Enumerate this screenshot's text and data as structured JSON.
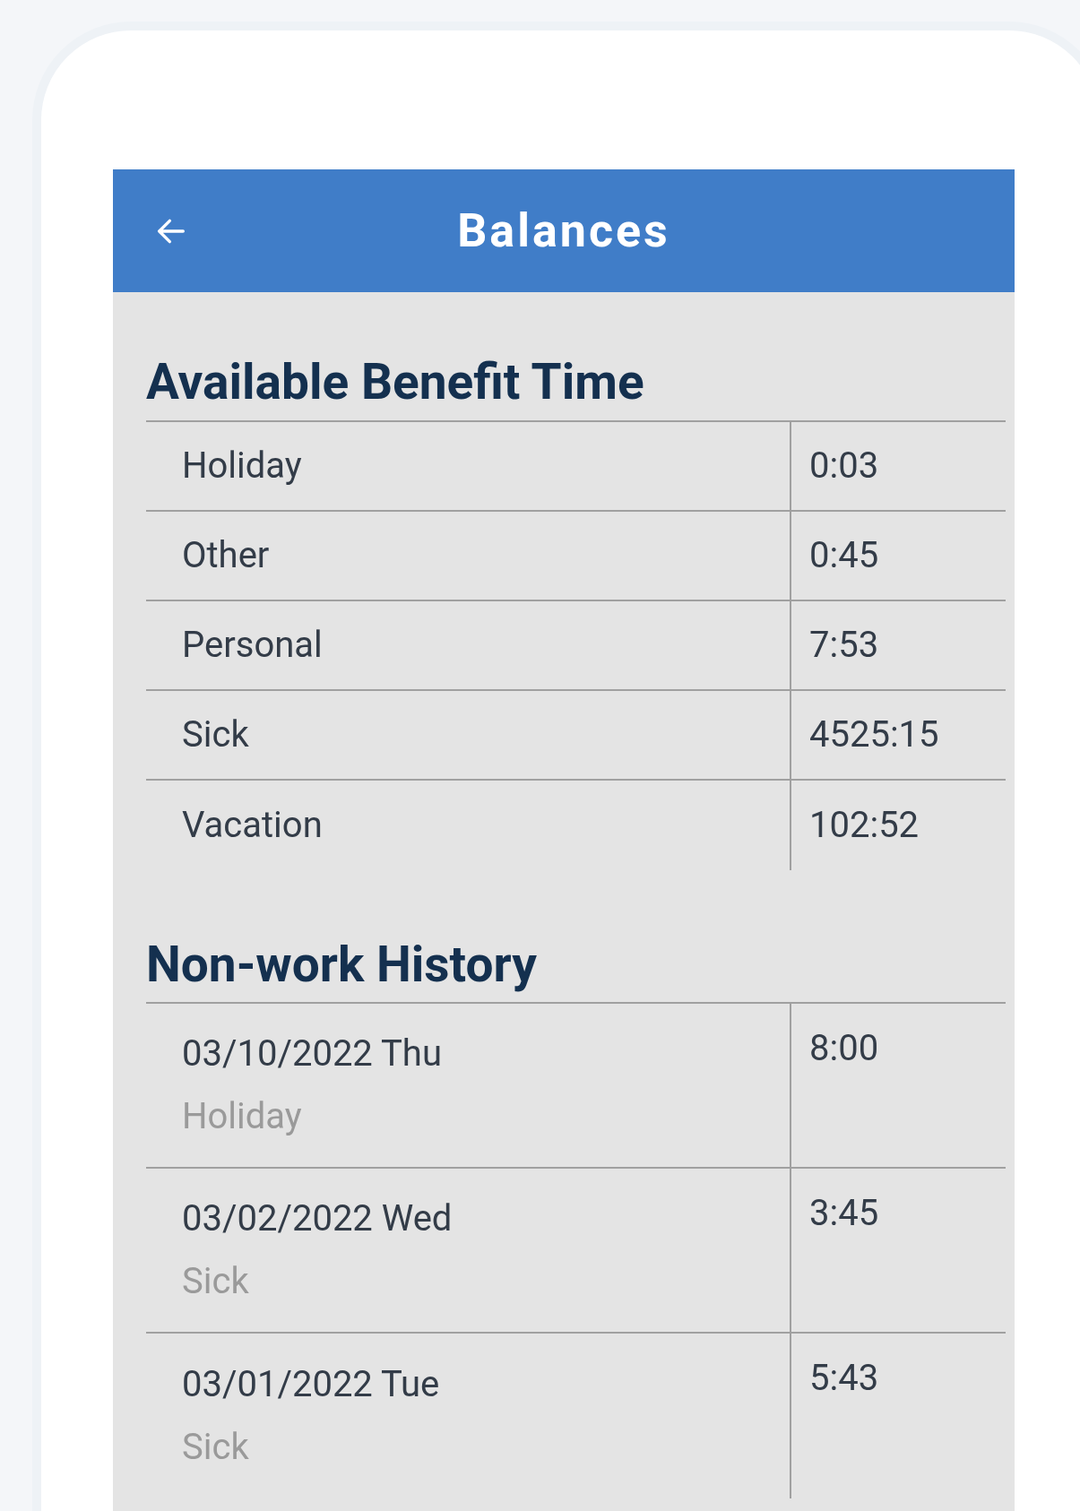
{
  "app_bar": {
    "title": "Balances"
  },
  "benefit_time": {
    "heading": "Available Benefit Time",
    "rows": [
      {
        "type": "Holiday",
        "balance": "0:03"
      },
      {
        "type": "Other",
        "balance": "0:45"
      },
      {
        "type": "Personal",
        "balance": "7:53"
      },
      {
        "type": "Sick",
        "balance": "4525:15"
      },
      {
        "type": "Vacation",
        "balance": "102:52"
      }
    ]
  },
  "non_work_history": {
    "heading": "Non-work History",
    "rows": [
      {
        "date": "03/10/2022 Thu",
        "type": "Holiday",
        "hours": "8:00"
      },
      {
        "date": "03/02/2022 Wed",
        "type": "Sick",
        "hours": "3:45"
      },
      {
        "date": "03/01/2022 Tue",
        "type": "Sick",
        "hours": "5:43"
      }
    ]
  }
}
